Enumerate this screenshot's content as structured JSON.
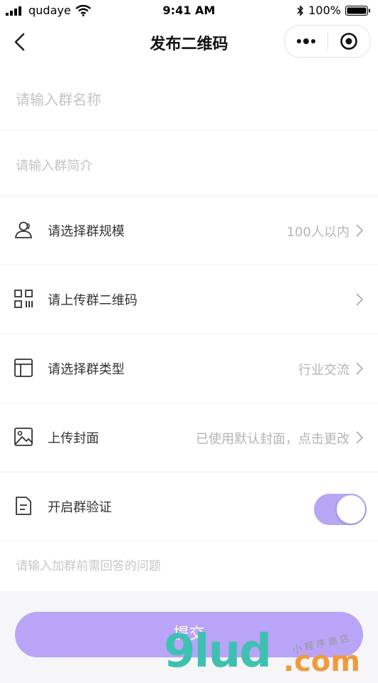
{
  "status": {
    "carrier": "qudaye",
    "time": "9:41 AM",
    "battery": "100%"
  },
  "nav": {
    "title": "发布二维码"
  },
  "form": {
    "name_placeholder": "请输入群名称",
    "intro_placeholder": "请输入群简介",
    "rows": [
      {
        "icon": "user-icon",
        "label": "请选择群规模",
        "value": "100人以内"
      },
      {
        "icon": "qrcode-icon",
        "label": "请上传群二维码",
        "value": ""
      },
      {
        "icon": "layout-icon",
        "label": "请选择群类型",
        "value": "行业交流"
      },
      {
        "icon": "image-icon",
        "label": "上传封面",
        "value": "已使用默认封面，点击更改"
      }
    ],
    "verify_label": "开启群验证",
    "verify_on": true,
    "question_placeholder": "请输入加群前需回答的问题"
  },
  "submit_label": "提交",
  "watermark": {
    "main": "9lud",
    "com": ".com",
    "script": "小程序商店"
  },
  "colors": {
    "accent": "#b9a4f7",
    "toggle": "#b7a6f4"
  }
}
